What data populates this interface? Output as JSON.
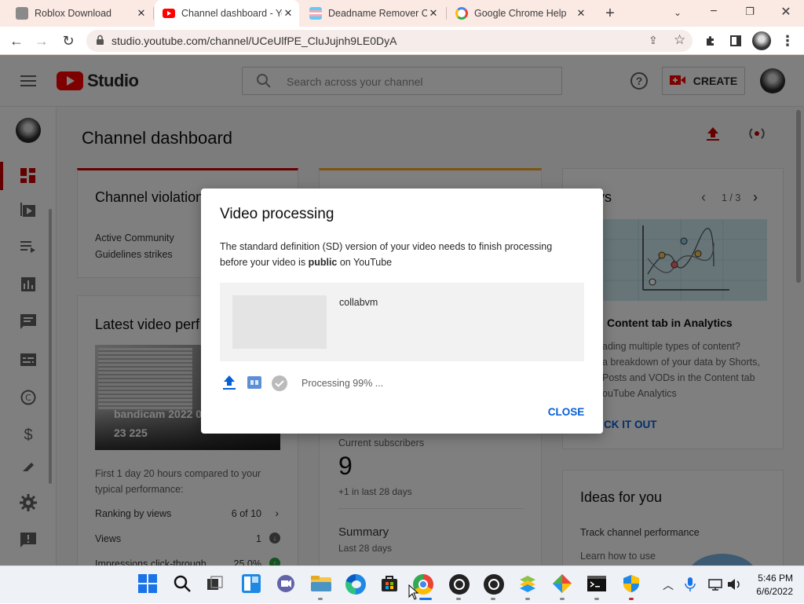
{
  "browser": {
    "tabs": [
      {
        "label": "Roblox Download",
        "favicon": "roblox-icon"
      },
      {
        "label": "Channel dashboard - Yo",
        "favicon": "youtube-icon",
        "active": true
      },
      {
        "label": "Deadname Remover C",
        "favicon": "trans-flag-icon"
      },
      {
        "label": "Google Chrome Help",
        "favicon": "google-icon"
      }
    ],
    "new_tab": "+",
    "url": "studio.youtube.com/channel/UCeUlfPE_CluJujnh9LE0DyA"
  },
  "studio": {
    "logo_text": "Studio",
    "search_placeholder": "Search across your channel",
    "create_label": "CREATE",
    "page_title": "Channel dashboard",
    "violations": {
      "title": "Channel violation",
      "label_line1": "Active Community",
      "label_line2": "Guidelines strikes"
    },
    "latest_video": {
      "title": "Latest video perf",
      "thumb_title": "bandicam 2022 0",
      "thumb_count": "23 225",
      "compare_text": "First 1 day 20 hours compared to your typical performance:",
      "rows": [
        {
          "label": "Ranking by views",
          "value": "6 of 10"
        },
        {
          "label": "Views",
          "value": "1"
        },
        {
          "label": "Impressions click-through",
          "value": "25.0%"
        }
      ]
    },
    "analytics": {
      "current_subscribers_label": "Current subscribers",
      "subscribers": "9",
      "subs_change": "+1 in last 28 days",
      "summary_title": "Summary",
      "summary_sub": "Last 28 days"
    },
    "news": {
      "title_fragment": "vs",
      "pager": "1 / 3",
      "headline": "Content tab in Analytics",
      "body_lines": [
        "ading multiple types of content?",
        "a breakdown of your data by Shorts,",
        "Posts and VODs in the Content tab",
        "ouTube Analytics"
      ],
      "cta": "CK IT OUT"
    },
    "ideas": {
      "title": "Ideas for you",
      "item_title": "Track channel performance",
      "item_sub": "Learn how to use"
    }
  },
  "dialog": {
    "title": "Video processing",
    "body_part1": "The standard definition (SD) version of your video needs to finish processing before your video is ",
    "body_bold": "public",
    "body_part2": " on YouTube",
    "video_title": "collabvm",
    "status_text": "Processing 99% ...",
    "progress": 0.99,
    "close_label": "CLOSE"
  },
  "taskbar": {
    "time": "5:46 PM",
    "date": "6/6/2022"
  },
  "colors": {
    "accent_blue": "#065fd4",
    "youtube_red": "#ff0000",
    "tab_bg": "#fbe9e4"
  }
}
